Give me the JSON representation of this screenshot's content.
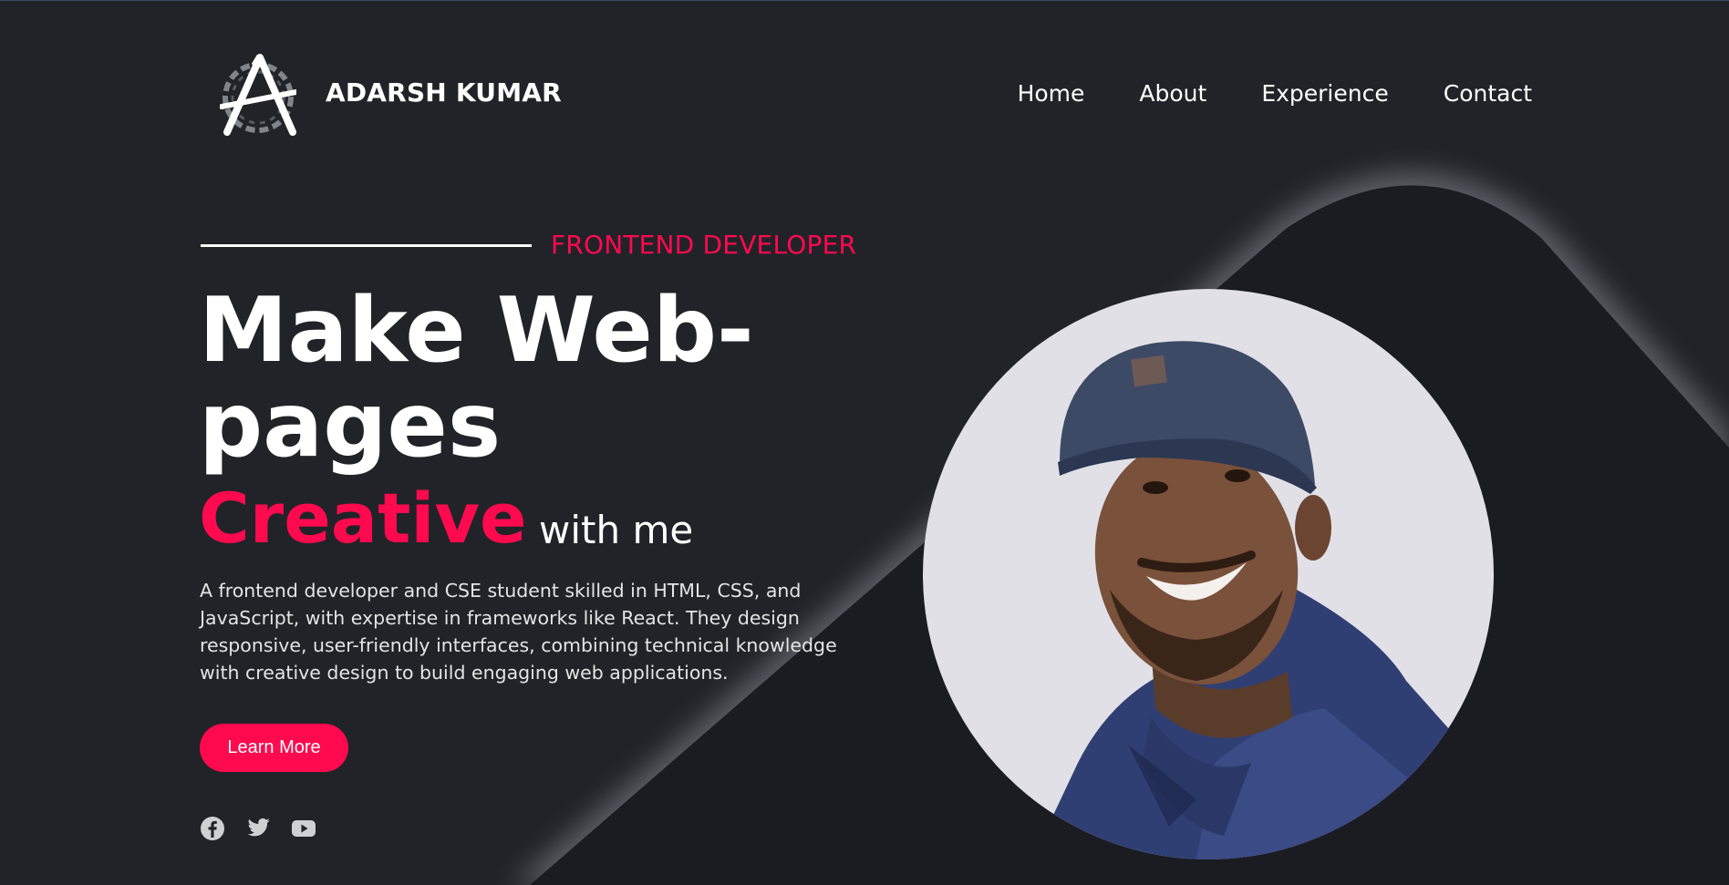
{
  "header": {
    "brand": "ADARSH KUMAR",
    "logo_icon": "letter-a-brush-logo",
    "nav": [
      "Home",
      "About",
      "Experience",
      "Contact"
    ]
  },
  "hero": {
    "tag": "FRONTEND DEVELOPER",
    "headline": "Make Web-pages",
    "highlight": "Creative",
    "suffix": "with me",
    "description": "A frontend developer and CSE student skilled in HTML, CSS, and JavaScript, with expertise in frameworks like React. They design responsive, user-friendly interfaces, combining technical knowledge with creative design to build engaging web applications.",
    "button": "Learn More",
    "socials": [
      "facebook-icon",
      "twitter-icon",
      "youtube-icon"
    ],
    "photo": "profile-photo"
  },
  "colors": {
    "background": "#222328",
    "accent": "#ff0a4e",
    "shape": "#1a1c21",
    "photo_bg": "#e1e0e6"
  }
}
